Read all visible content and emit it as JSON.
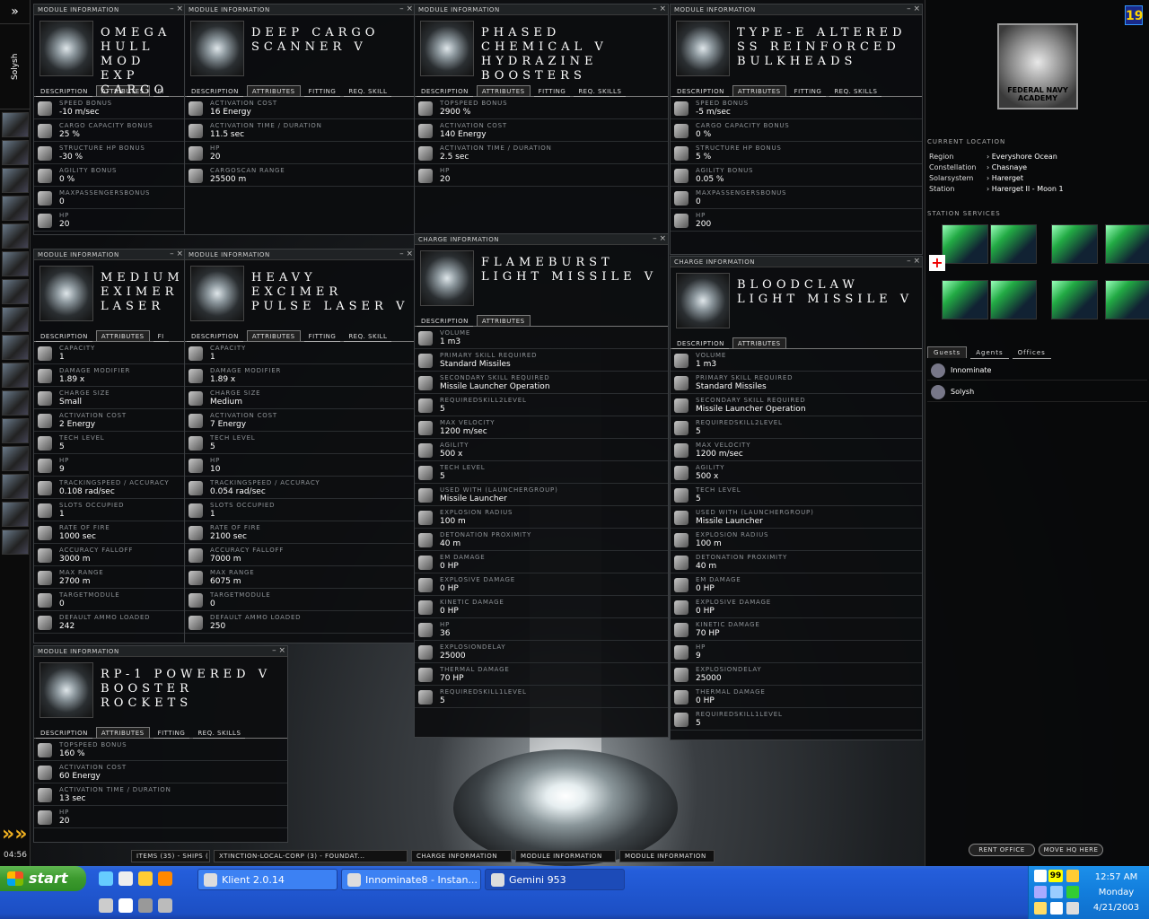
{
  "sidebar": {
    "top_icon": "»",
    "name": "Solysh",
    "clock": "04:56",
    "arrow": "»»",
    "icons": [
      "character-icon",
      "cargo-icon",
      "mail-icon",
      "map-icon",
      "network-icon",
      "assets-icon",
      "skills-icon",
      "ring-icon",
      "people-icon",
      "world-icon",
      "tools-icon",
      "journal-icon",
      "audio-icon",
      "market-icon",
      "ship-icon",
      "station-icon"
    ]
  },
  "corner_badge": "19",
  "windows": [
    {
      "id": "omega",
      "title": "Module Information",
      "name": "Omega Hull Mod Expanded Cargo",
      "name_display": "OMEGA HULL MOD EXP CARGO",
      "thumb": "cargo-module-icon",
      "tabs": [
        "Description",
        "Attributes",
        "Fi"
      ],
      "active": 1,
      "attrs": [
        [
          "Speed Bonus",
          "-10 m/sec"
        ],
        [
          "Cargo Capacity Bonus",
          "25 %"
        ],
        [
          "Structure HP Bonus",
          "-30 %"
        ],
        [
          "Agility Bonus",
          "0 %"
        ],
        [
          "Maxpassengersbonus",
          "0"
        ],
        [
          "HP",
          "20"
        ]
      ]
    },
    {
      "id": "deepcargo",
      "title": "Module Information",
      "name_display": "DEEP CARGO SCANNER V",
      "thumb": "scanner-icon",
      "tabs": [
        "Description",
        "Attributes",
        "Fitting",
        "Req. Skill"
      ],
      "active": 1,
      "attrs": [
        [
          "Activation Cost",
          "16 Energy"
        ],
        [
          "Activation Time / Duration",
          "11.5 sec"
        ],
        [
          "HP",
          "20"
        ],
        [
          "Cargoscan Range",
          "25500 m"
        ]
      ]
    },
    {
      "id": "phased",
      "title": "Module Information",
      "name_display": "PHASED CHEMICAL V HYDRAZINE BOOSTERS",
      "thumb": "booster-icon",
      "tabs": [
        "Description",
        "Attributes",
        "Fitting",
        "Req. Skills"
      ],
      "active": 1,
      "attrs": [
        [
          "Topspeed Bonus",
          "2900 %"
        ],
        [
          "Activation Cost",
          "140 Energy"
        ],
        [
          "Activation Time / Duration",
          "2.5 sec"
        ],
        [
          "HP",
          "20"
        ]
      ]
    },
    {
      "id": "typee",
      "title": "Module Information",
      "name_display": "TYPE-E ALTERED SS REINFORCED BULKHEADS",
      "thumb": "bulkhead-icon",
      "tabs": [
        "Description",
        "Attributes",
        "Fitting",
        "Req. Skills"
      ],
      "active": 1,
      "attrs": [
        [
          "Speed Bonus",
          "-5 m/sec"
        ],
        [
          "Cargo Capacity Bonus",
          "0 %"
        ],
        [
          "Structure HP Bonus",
          "5 %"
        ],
        [
          "Agility Bonus",
          "0.05 %"
        ],
        [
          "Maxpassengersbonus",
          "0"
        ],
        [
          "HP",
          "200"
        ]
      ]
    },
    {
      "id": "medium",
      "title": "Module Information",
      "name_display": "MEDIUM EXIMER LASER",
      "thumb": "laser-icon",
      "tabs": [
        "Description",
        "Attributes",
        "Fi"
      ],
      "active": 1,
      "attrs": [
        [
          "Capacity",
          "1"
        ],
        [
          "Damage Modifier",
          "1.89 x"
        ],
        [
          "Charge Size",
          "Small"
        ],
        [
          "Activation Cost",
          "2 Energy"
        ],
        [
          "Tech Level",
          "5"
        ],
        [
          "HP",
          "9"
        ],
        [
          "Trackingspeed / Accuracy",
          "0.108 rad/sec"
        ],
        [
          "Slots Occupied",
          "1"
        ],
        [
          "Rate of Fire",
          "1000 sec"
        ],
        [
          "Accuracy Falloff",
          "3000 m"
        ],
        [
          "Max Range",
          "2700 m"
        ],
        [
          "Targetmodule",
          "0"
        ],
        [
          "Default Ammo Loaded",
          "242"
        ]
      ]
    },
    {
      "id": "heavy",
      "title": "Module Information",
      "name_display": "HEAVY EXCIMER PULSE LASER V",
      "thumb": "pulse-laser-icon",
      "tabs": [
        "Description",
        "Attributes",
        "Fitting",
        "Req. Skill"
      ],
      "active": 1,
      "attrs": [
        [
          "Capacity",
          "1"
        ],
        [
          "Damage Modifier",
          "1.89 x"
        ],
        [
          "Charge Size",
          "Medium"
        ],
        [
          "Activation Cost",
          "7 Energy"
        ],
        [
          "Tech Level",
          "5"
        ],
        [
          "HP",
          "10"
        ],
        [
          "Trackingspeed / Accuracy",
          "0.054 rad/sec"
        ],
        [
          "Slots Occupied",
          "1"
        ],
        [
          "Rate of Fire",
          "2100 sec"
        ],
        [
          "Accuracy Falloff",
          "7000 m"
        ],
        [
          "Max Range",
          "6075 m"
        ],
        [
          "Targetmodule",
          "0"
        ],
        [
          "Default Ammo Loaded",
          "250"
        ]
      ]
    },
    {
      "id": "flameburst",
      "title": "Charge Information",
      "name_display": "FLAMEBURST LIGHT MISSILE V",
      "thumb": "missile-icon",
      "tabs": [
        "Description",
        "Attributes"
      ],
      "active": 1,
      "attrs": [
        [
          "Volume",
          "1 m3"
        ],
        [
          "Primary Skill Required",
          "Standard Missiles"
        ],
        [
          "Secondary Skill Required",
          "Missile Launcher Operation"
        ],
        [
          "Requiredskill2level",
          "5"
        ],
        [
          "Max Velocity",
          "1200 m/sec"
        ],
        [
          "Agility",
          "500 x"
        ],
        [
          "Tech Level",
          "5"
        ],
        [
          "Used With (Launchergroup)",
          "Missile Launcher"
        ],
        [
          "Explosion Radius",
          "100 m"
        ],
        [
          "Detonation Proximity",
          "40 m"
        ],
        [
          "EM Damage",
          "0 HP"
        ],
        [
          "Explosive Damage",
          "0 HP"
        ],
        [
          "Kinetic Damage",
          "0 HP"
        ],
        [
          "HP",
          "36"
        ],
        [
          "Explosiondelay",
          "25000"
        ],
        [
          "Thermal Damage",
          "70 HP"
        ],
        [
          "Requiredskill1level",
          "5"
        ]
      ]
    },
    {
      "id": "bloodclaw",
      "title": "Charge Information",
      "name_display": "BLOODCLAW LIGHT MISSILE V",
      "thumb": "missile-icon",
      "tabs": [
        "Description",
        "Attributes"
      ],
      "active": 1,
      "attrs": [
        [
          "Volume",
          "1 m3"
        ],
        [
          "Primary Skill Required",
          "Standard Missiles"
        ],
        [
          "Secondary Skill Required",
          "Missile Launcher Operation"
        ],
        [
          "Requiredskill2level",
          "5"
        ],
        [
          "Max Velocity",
          "1200 m/sec"
        ],
        [
          "Agility",
          "500 x"
        ],
        [
          "Tech Level",
          "5"
        ],
        [
          "Used With (Launchergroup)",
          "Missile Launcher"
        ],
        [
          "Explosion Radius",
          "100 m"
        ],
        [
          "Detonation Proximity",
          "40 m"
        ],
        [
          "EM Damage",
          "0 HP"
        ],
        [
          "Explosive Damage",
          "0 HP"
        ],
        [
          "Kinetic Damage",
          "70 HP"
        ],
        [
          "HP",
          "9"
        ],
        [
          "Explosiondelay",
          "25000"
        ],
        [
          "Thermal Damage",
          "0 HP"
        ],
        [
          "Requiredskill1level",
          "5"
        ]
      ]
    },
    {
      "id": "rp1",
      "title": "Module Information",
      "name_display": "RP-1 POWERED V BOOSTER ROCKETS",
      "thumb": "booster-icon",
      "tabs": [
        "Description",
        "Attributes",
        "Fitting",
        "Req. Skills"
      ],
      "active": 1,
      "attrs": [
        [
          "Topspeed Bonus",
          "160 %"
        ],
        [
          "Activation Cost",
          "60 Energy"
        ],
        [
          "Activation Time / Duration",
          "13 sec"
        ],
        [
          "HP",
          "20"
        ]
      ]
    }
  ],
  "station": {
    "logo_text": "FEDERAL NAVY ACADEMY",
    "location_title": "Current Location",
    "location": [
      [
        "Region",
        "Everyshore Ocean"
      ],
      [
        "Constellation",
        "Chasnaye"
      ],
      [
        "Solarsystem",
        "Harerget"
      ],
      [
        "Station",
        "Harerget II - Moon 1"
      ]
    ],
    "services_title": "Station Services",
    "services": [
      "repair-service-icon",
      "fitting-service-icon",
      "reprocessing-service-icon",
      "market-service-icon",
      "factory-service-icon",
      "lab-service-icon",
      "insurance-service-icon",
      "bounty-service-icon",
      "medical-icon"
    ],
    "guest_tabs": [
      "Guests",
      "Agents",
      "Offices"
    ],
    "guests": [
      "Innominate",
      "Solysh"
    ],
    "buttons": [
      "Rent Office",
      "Move HQ Here"
    ]
  },
  "window_strip": [
    "Items (35) - Ships (1)",
    "Xtinction-local-Corp (3) - Foundat...",
    "Charge Information",
    "Module Information",
    "Module Information"
  ],
  "taskbar": {
    "start": "start",
    "tasks": [
      "Klient 2.0.14",
      "Innominate8 - Instan...",
      "Gemini 953"
    ],
    "clock_time": "12:57 AM",
    "clock_day": "Monday",
    "clock_date": "4/21/2003",
    "tray_number": "99"
  }
}
